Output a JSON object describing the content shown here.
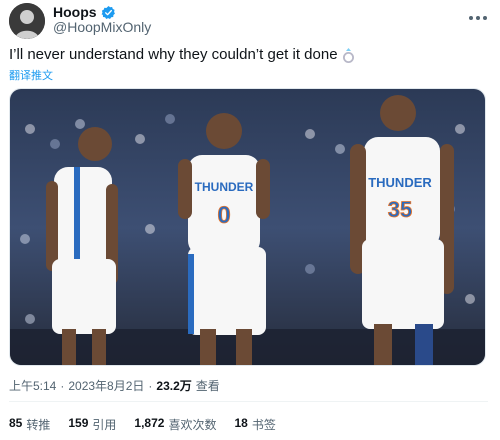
{
  "tweet": {
    "display_name": "Hoops",
    "handle": "@HoopMixOnly",
    "text": "I’ll never understand why they couldn’t get it done",
    "translate_label": "翻译推文",
    "time": "上午5:14",
    "date": "2023年8月2日",
    "views_count": "23.2万",
    "views_label": "查看",
    "stats": [
      {
        "count": "85",
        "label": "转推"
      },
      {
        "count": "159",
        "label": "引用"
      },
      {
        "count": "1,872",
        "label": "喜欢次数"
      },
      {
        "count": "18",
        "label": "书签"
      }
    ]
  },
  "media": {
    "jerseys": [
      {
        "team": "THUNDER",
        "number": ""
      },
      {
        "team": "THUNDER",
        "number": "0"
      },
      {
        "team": "THUNDER",
        "number": "35"
      }
    ]
  },
  "colors": {
    "accent": "#1d9bf0",
    "secondary_text": "#536471",
    "jersey_blue": "#2a6bbf",
    "jersey_orange": "#e8762c"
  },
  "icons": {
    "verified": "verified-icon",
    "more": "more-icon",
    "ring": "ring-emoji-icon"
  }
}
